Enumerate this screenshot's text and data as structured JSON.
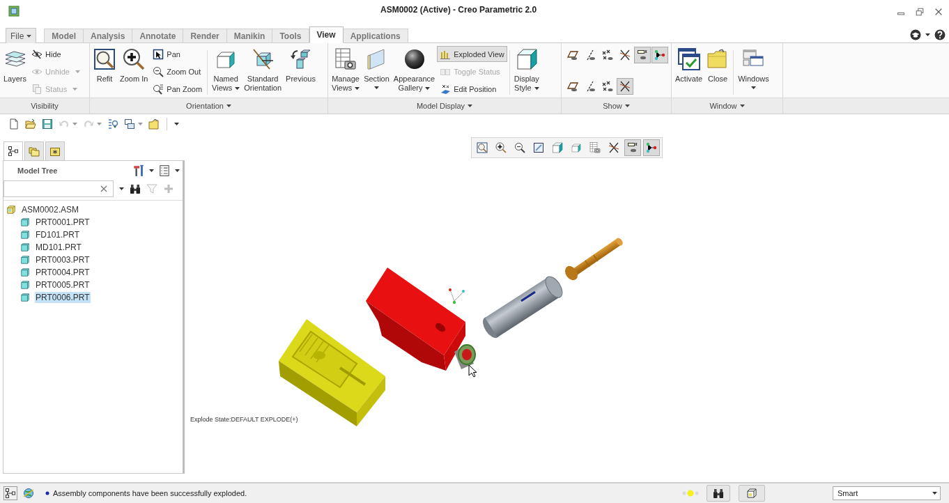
{
  "window": {
    "title": "ASM0002 (Active) - Creo Parametric 2.0"
  },
  "file_menu": {
    "label": "File"
  },
  "tabs": [
    {
      "label": "Model",
      "selected": false
    },
    {
      "label": "Analysis",
      "selected": false
    },
    {
      "label": "Annotate",
      "selected": false
    },
    {
      "label": "Render",
      "selected": false
    },
    {
      "label": "Manikin",
      "selected": false
    },
    {
      "label": "Tools",
      "selected": false
    },
    {
      "label": "View",
      "selected": true
    },
    {
      "label": "Applications",
      "selected": false
    }
  ],
  "ribbon": {
    "groups": [
      {
        "label": "Visibility",
        "menu": false,
        "items": [
          {
            "kind": "large",
            "label": "Layers",
            "menu": false
          },
          {
            "kind": "stack",
            "buttons": [
              {
                "label": "Hide",
                "disabled": false,
                "menu": false,
                "on": false
              },
              {
                "label": "Unhide",
                "disabled": true,
                "menu": true,
                "on": false
              },
              {
                "label": "Status",
                "disabled": true,
                "menu": true,
                "on": false
              }
            ]
          }
        ]
      },
      {
        "label": "Orientation",
        "menu": true,
        "items": [
          {
            "kind": "large",
            "label": "Refit",
            "menu": false
          },
          {
            "kind": "large",
            "label": "Zoom In",
            "menu": false
          },
          {
            "kind": "stack",
            "buttons": [
              {
                "label": "Pan",
                "disabled": false,
                "menu": false,
                "on": false
              },
              {
                "label": "Zoom Out",
                "disabled": false,
                "menu": false,
                "on": false
              },
              {
                "label": "Pan Zoom",
                "disabled": false,
                "menu": false,
                "on": false
              }
            ]
          },
          {
            "kind": "separator"
          },
          {
            "kind": "large",
            "label": "Named\nViews",
            "menu": true
          },
          {
            "kind": "large",
            "label": "Standard\nOrientation",
            "menu": false
          },
          {
            "kind": "large",
            "label": "Previous",
            "menu": false
          }
        ]
      },
      {
        "label": "Model Display",
        "menu": true,
        "items": [
          {
            "kind": "large",
            "label": "Manage\nViews",
            "menu": true
          },
          {
            "kind": "split",
            "label": "Section"
          },
          {
            "kind": "large",
            "label": "Appearance\nGallery",
            "menu": true
          },
          {
            "kind": "stack",
            "buttons": [
              {
                "label": "Exploded View",
                "disabled": false,
                "menu": false,
                "on": true
              },
              {
                "label": "Toggle Status",
                "disabled": true,
                "menu": false,
                "on": false
              },
              {
                "label": "Edit Position",
                "disabled": false,
                "menu": false,
                "on": false
              }
            ]
          },
          {
            "kind": "separator"
          },
          {
            "kind": "large",
            "label": "Display\nStyle",
            "menu": true
          }
        ]
      },
      {
        "label": "Show",
        "menu": true,
        "items": [
          {
            "kind": "icon_grid",
            "rows": [
              [
                {
                  "pressed": false
                },
                {
                  "pressed": false
                },
                {
                  "pressed": false
                },
                {
                  "pressed": false
                },
                {
                  "pressed": true
                },
                {
                  "pressed": true
                }
              ],
              [
                {
                  "pressed": false
                },
                {
                  "pressed": false
                },
                {
                  "pressed": false
                },
                {
                  "pressed": true
                }
              ]
            ]
          }
        ]
      },
      {
        "label": "Window",
        "menu": true,
        "items": [
          {
            "kind": "large",
            "label": "Activate",
            "menu": false
          },
          {
            "kind": "large",
            "label": "Close",
            "menu": false
          },
          {
            "kind": "separator"
          },
          {
            "kind": "split",
            "label": "Windows"
          }
        ]
      }
    ]
  },
  "quick_access": [
    {
      "disabled": false,
      "menu": false
    },
    {
      "disabled": false,
      "menu": false
    },
    {
      "disabled": false,
      "menu": false
    },
    {
      "disabled": true,
      "menu": true
    },
    {
      "disabled": true,
      "menu": true
    },
    {
      "disabled": false,
      "menu": false
    },
    {
      "disabled": false,
      "menu": true
    },
    {
      "disabled": false,
      "menu": false
    }
  ],
  "model_tree": {
    "panel_tabs": [
      {
        "selected": true
      },
      {
        "selected": false
      },
      {
        "selected": false
      }
    ],
    "title": "Model Tree",
    "search_tools": [
      {
        "disabled": false
      },
      {
        "disabled": true
      },
      {
        "disabled": true
      }
    ],
    "tree": [
      {
        "label": "ASM0002.ASM",
        "selected": false,
        "children": [
          {
            "label": "PRT0001.PRT",
            "selected": false
          },
          {
            "label": "FD101.PRT",
            "selected": false
          },
          {
            "label": "MD101.PRT",
            "selected": false
          },
          {
            "label": "PRT0003.PRT",
            "selected": false
          },
          {
            "label": "PRT0004.PRT",
            "selected": false
          },
          {
            "label": "PRT0005.PRT",
            "selected": false
          },
          {
            "label": "PRT0006.PRT",
            "selected": true
          }
        ]
      }
    ]
  },
  "view_toolbar": [
    {
      "pressed": false
    },
    {
      "pressed": false
    },
    {
      "pressed": false
    },
    {
      "pressed": false
    },
    {
      "pressed": false
    },
    {
      "pressed": false
    },
    {
      "pressed": false
    },
    {
      "pressed": false
    },
    {
      "pressed": true
    },
    {
      "pressed": true
    }
  ],
  "viewport": {
    "explode_state": "Explode State:DEFAULT EXPLODE(+)"
  },
  "status_bar": {
    "message": "Assembly components have been successfully exploded.",
    "selection_filter": "Smart"
  }
}
